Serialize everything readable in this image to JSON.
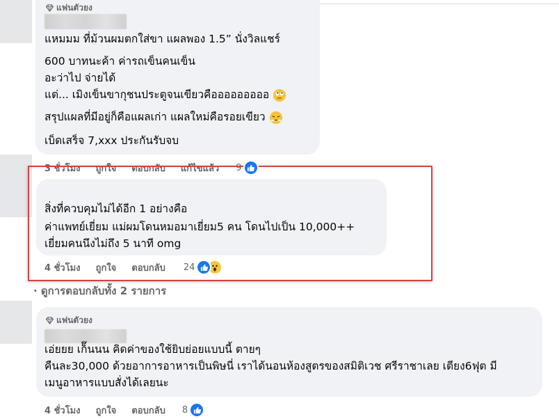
{
  "colors": {
    "bubble_bg": "#f0f2f5",
    "action_text": "#65676b",
    "like_blue": "#1877f2",
    "highlight_red": "#d9413e"
  },
  "comments": [
    {
      "badge": "แฟนตัวยง",
      "lines": [
        "แหมมม ที่ม้วนผมตกใส่ขา แผลพอง 1.5” นั่งวิลแชร์",
        "600 บาทนะค้า ค่ารถเข็นคนเข็น",
        "อะว่าไป จ่ายได้",
        "แต่... เมิงเข็นขากุชนประตูจนเขียวคือออออออออ",
        "สรุปแผลที่มีอยู่ก็คือแผลเก่า แผลใหม่คือรอยเขียว",
        "เบ็ดเสร็จ 7,xxx ประกันรับจบ"
      ],
      "emoji_line4": "face-with-rolling-eyes",
      "emoji_line5": "face-with-steam",
      "time": "3 ชั่วโมง",
      "like": "ถูกใจ",
      "reply": "ตอบกลับ",
      "edited": "แก้ไขแล้ว",
      "reaction_count": "9"
    },
    {
      "lines": [
        "สิ่งที่ควบคุมไม่ได้อีก 1 อย่างคือ",
        "ค่าแพทย์เยี่ยม แม่ผมโดนหมอมาเยี่ยม5 คน โดนไปเป็น 10,000++",
        "เยี่ยมคนนึงไม่ถึง 5 นาที omg"
      ],
      "time": "4 ชั่วโมง",
      "like": "ถูกใจ",
      "reply": "ตอบกลับ",
      "reaction_count": "24"
    },
    {
      "badge": "แฟนตัวยง",
      "lines": [
        "เอ่ยยย เก็๊นนน คิดค่าของใช้ยิบย่อยแบบนี้ ตายๆ",
        "คืนละ30,000 ด้วยอาการอาหารเป็นพิษนี่ เราได้นอนห้องสูตรของสมิติเวช ศรีราชาเลย เตียง6ฟุต มี",
        "เมนูอาหารแบบสั่งได้เลยนะ"
      ],
      "time": "4 ชั่วโมง",
      "like": "ถูกใจ",
      "reply": "ตอบกลับ",
      "reaction_count": "8"
    }
  ],
  "more_replies": "· ดูการตอบกลับทั้ง 2 รายการ"
}
